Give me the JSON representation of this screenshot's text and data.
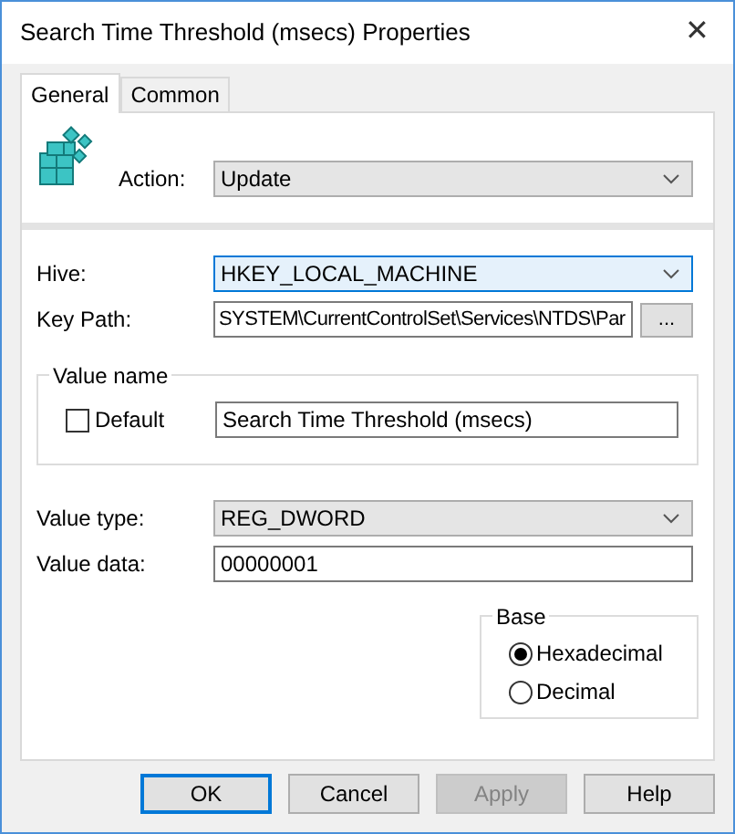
{
  "window": {
    "title": "Search Time Threshold (msecs) Properties",
    "close": "✕"
  },
  "tabs": [
    {
      "label": "General",
      "selected": true
    },
    {
      "label": "Common",
      "selected": false
    }
  ],
  "action": {
    "label": "Action:",
    "value": "Update"
  },
  "hive": {
    "label": "Hive:",
    "value": "HKEY_LOCAL_MACHINE",
    "focused": true
  },
  "key_path": {
    "label": "Key Path:",
    "value": "SYSTEM\\CurrentControlSet\\Services\\NTDS\\Par",
    "browse": "..."
  },
  "value_name": {
    "title": "Value name",
    "default": {
      "label": "Default",
      "checked": false
    },
    "value": "Search Time Threshold (msecs)"
  },
  "value_type": {
    "label": "Value type:",
    "value": "REG_DWORD"
  },
  "value_data": {
    "label": "Value data:",
    "value": "00000001"
  },
  "base": {
    "title": "Base",
    "options": [
      {
        "label": "Hexadecimal",
        "selected": true
      },
      {
        "label": "Decimal",
        "selected": false
      }
    ]
  },
  "buttons": [
    {
      "label": "OK",
      "default": true,
      "disabled": false
    },
    {
      "label": "Cancel",
      "default": false,
      "disabled": false
    },
    {
      "label": "Apply",
      "default": false,
      "disabled": true
    },
    {
      "label": "Help",
      "default": false,
      "disabled": false
    }
  ]
}
